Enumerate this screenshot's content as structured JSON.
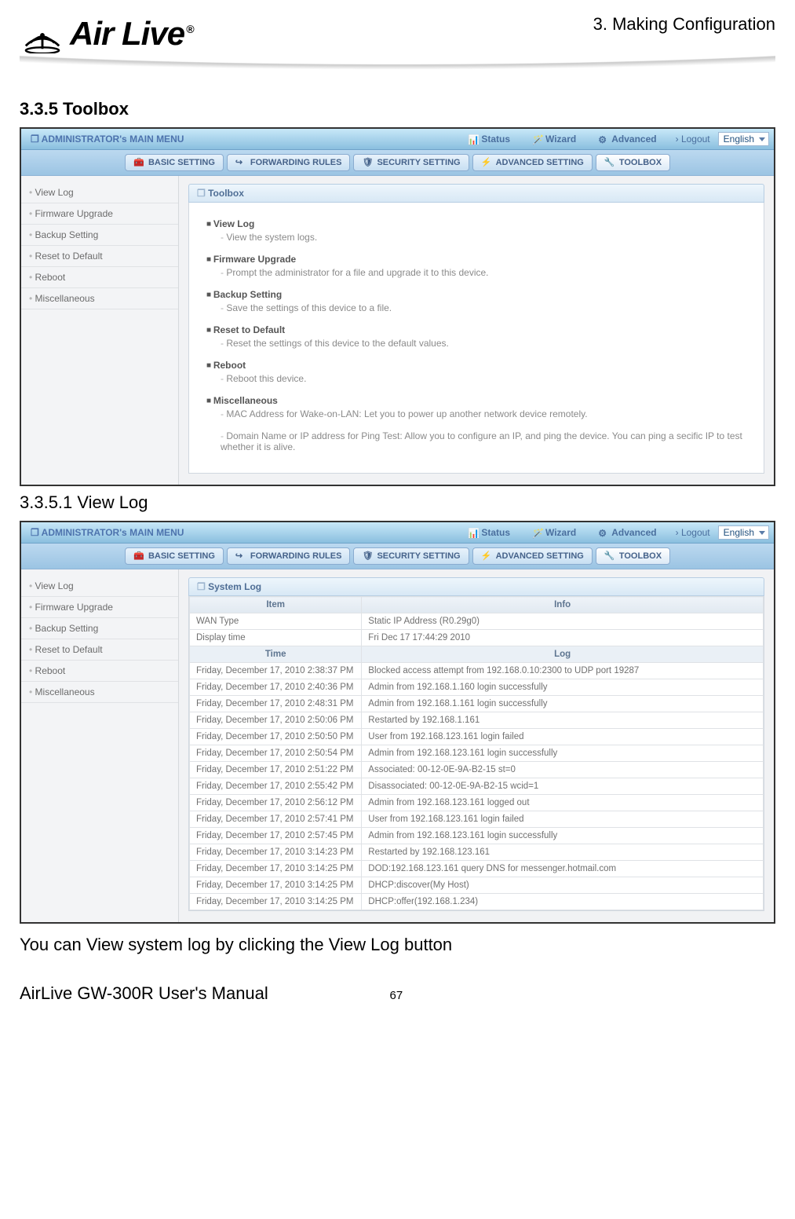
{
  "chapter": "3. Making Configuration",
  "brand": "Air Live",
  "section_heading": "3.3.5 Toolbox",
  "subheading": "3.3.5.1 View Log",
  "body_text": "You can View system log by clicking the View Log button",
  "footer_left": "AirLive GW-300R User's Manual",
  "page_number": "67",
  "admin": {
    "title": "ADMINISTRATOR's MAIN MENU",
    "menuitems": [
      "Status",
      "Wizard",
      "Advanced"
    ],
    "logout": "Logout",
    "language": "English",
    "tabs": [
      "BASIC SETTING",
      "FORWARDING RULES",
      "SECURITY SETTING",
      "ADVANCED SETTING",
      "TOOLBOX"
    ],
    "active_tab_index": 4,
    "sidebar": [
      "View Log",
      "Firmware Upgrade",
      "Backup Setting",
      "Reset to Default",
      "Reboot",
      "Miscellaneous"
    ]
  },
  "toolbox_panel": {
    "title": "Toolbox",
    "features": [
      {
        "title": "View Log",
        "desc": "View the system logs."
      },
      {
        "title": "Firmware Upgrade",
        "desc": "Prompt the administrator for a file and upgrade it to this device."
      },
      {
        "title": "Backup Setting",
        "desc": "Save the settings of this device to a file."
      },
      {
        "title": "Reset to Default",
        "desc": "Reset the settings of this device to the default values."
      },
      {
        "title": "Reboot",
        "desc": "Reboot this device."
      },
      {
        "title": "Miscellaneous",
        "desc": "MAC Address for Wake-on-LAN: Let you to power up another network device remotely."
      },
      {
        "title": "",
        "desc": "Domain Name or IP address for Ping Test: Allow you to configure an IP, and ping the device. You can ping a secific IP to test whether it is alive."
      }
    ]
  },
  "syslog_panel": {
    "title": "System Log",
    "info_header": [
      "Item",
      "Info"
    ],
    "info_rows": [
      [
        "WAN Type",
        "Static IP Address (R0.29g0)"
      ],
      [
        "Display time",
        "Fri Dec 17 17:44:29 2010"
      ]
    ],
    "log_header": [
      "Time",
      "Log"
    ],
    "log_rows": [
      [
        "Friday, December 17, 2010 2:38:37 PM",
        "Blocked access attempt from 192.168.0.10:2300 to UDP port 19287"
      ],
      [
        "Friday, December 17, 2010 2:40:36 PM",
        "Admin from 192.168.1.160 login successfully"
      ],
      [
        "Friday, December 17, 2010 2:48:31 PM",
        "Admin from 192.168.1.161 login successfully"
      ],
      [
        "Friday, December 17, 2010 2:50:06 PM",
        "Restarted by 192.168.1.161"
      ],
      [
        "Friday, December 17, 2010 2:50:50 PM",
        "User from 192.168.123.161 login failed"
      ],
      [
        "Friday, December 17, 2010 2:50:54 PM",
        "Admin from 192.168.123.161 login successfully"
      ],
      [
        "Friday, December 17, 2010 2:51:22 PM",
        "Associated: 00-12-0E-9A-B2-15 st=0"
      ],
      [
        "Friday, December 17, 2010 2:55:42 PM",
        "Disassociated: 00-12-0E-9A-B2-15 wcid=1"
      ],
      [
        "Friday, December 17, 2010 2:56:12 PM",
        "Admin from 192.168.123.161 logged out"
      ],
      [
        "Friday, December 17, 2010 2:57:41 PM",
        "User from 192.168.123.161 login failed"
      ],
      [
        "Friday, December 17, 2010 2:57:45 PM",
        "Admin from 192.168.123.161 login successfully"
      ],
      [
        "Friday, December 17, 2010 3:14:23 PM",
        "Restarted by 192.168.123.161"
      ],
      [
        "Friday, December 17, 2010 3:14:25 PM",
        "DOD:192.168.123.161 query DNS for messenger.hotmail.com"
      ],
      [
        "Friday, December 17, 2010 3:14:25 PM",
        "DHCP:discover(My Host)"
      ],
      [
        "Friday, December 17, 2010 3:14:25 PM",
        "DHCP:offer(192.168.1.234)"
      ]
    ]
  }
}
